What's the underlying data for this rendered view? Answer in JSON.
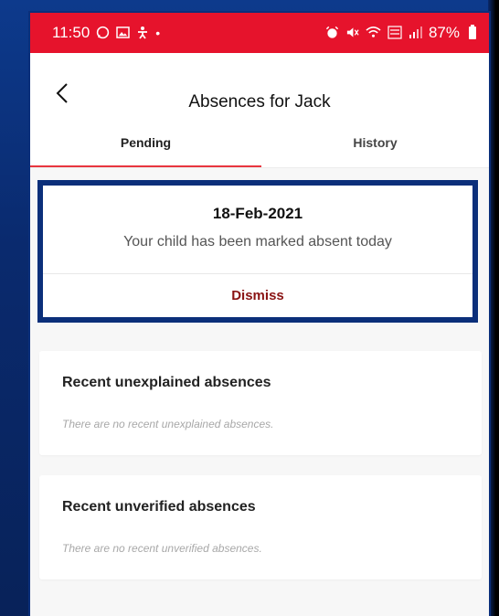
{
  "status_bar": {
    "time": "11:50",
    "battery": "87%",
    "left_icons": [
      "whatsapp-icon",
      "gallery-icon",
      "accessibility-icon",
      "dot-icon"
    ],
    "right_icons": [
      "alarm-icon",
      "mute-icon",
      "wifi-icon",
      "volte-icon",
      "signal-icon",
      "battery-icon"
    ],
    "color": "#e6132c"
  },
  "header": {
    "title": "Absences for Jack"
  },
  "tabs": [
    {
      "label": "Pending",
      "active": true
    },
    {
      "label": "History",
      "active": false
    }
  ],
  "notice": {
    "date": "18-Feb-2021",
    "message": "Your child has been marked absent today",
    "dismiss_label": "Dismiss"
  },
  "sections": [
    {
      "title": "Recent unexplained absences",
      "empty_text": "There are no recent unexplained absences."
    },
    {
      "title": "Recent unverified absences",
      "empty_text": "There are no recent unverified absences."
    }
  ],
  "colors": {
    "accent": "#e8363f",
    "dismiss": "#8a1414",
    "highlight_outline": "#0b2f7a"
  }
}
